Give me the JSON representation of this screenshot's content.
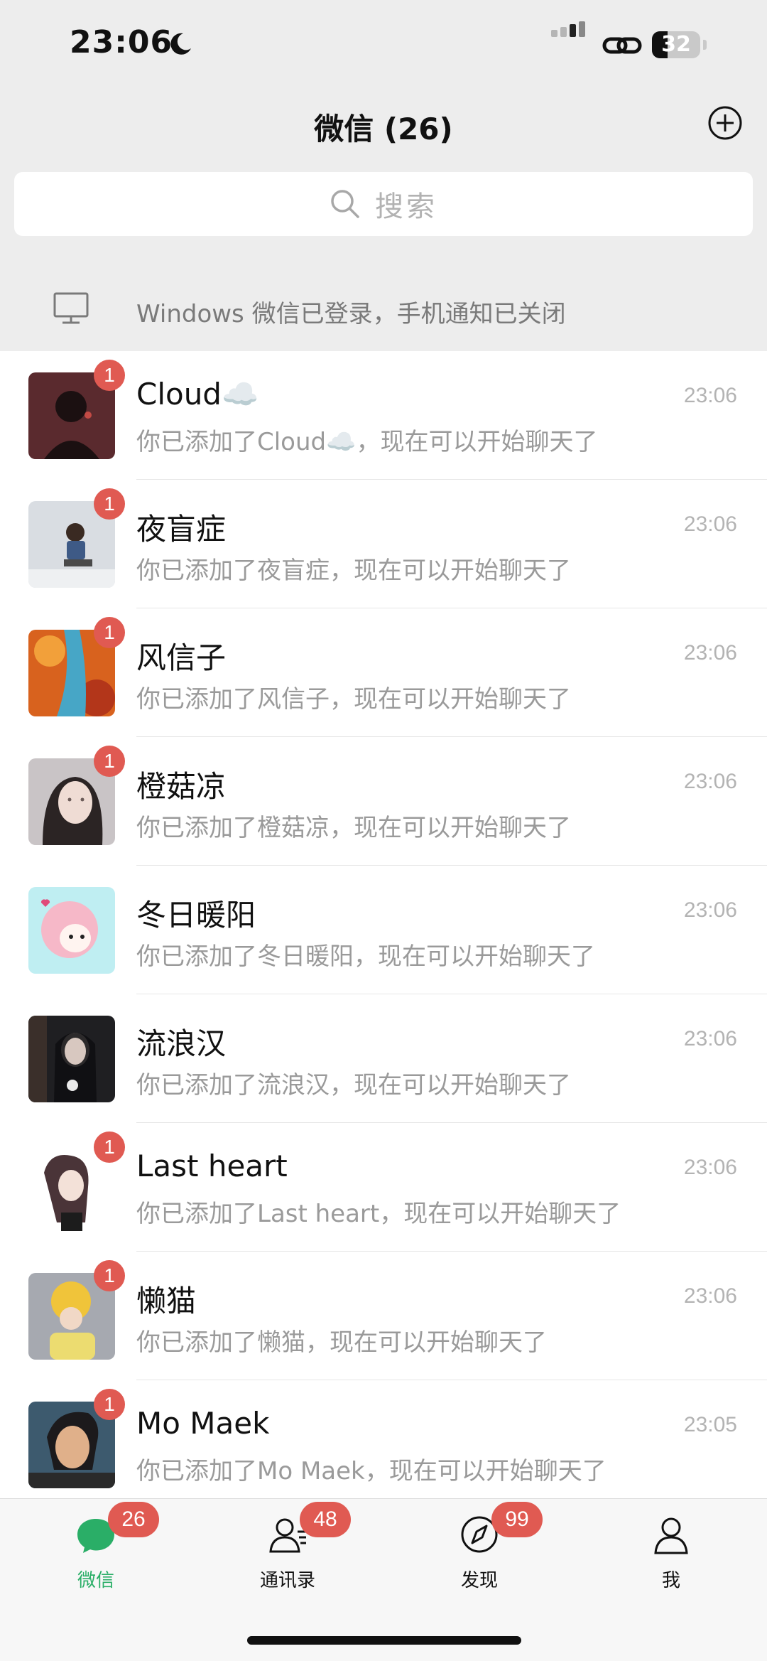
{
  "status_bar": {
    "time": "23:06",
    "battery": "32",
    "battery_level": 0.32
  },
  "header": {
    "title": "微信 (26)"
  },
  "search": {
    "placeholder": "搜索"
  },
  "login_notice": {
    "text": "Windows 微信已登录，手机通知已关闭"
  },
  "chats": [
    {
      "name": "Cloud☁️",
      "preview": "你已添加了Cloud☁️，现在可以开始聊天了",
      "time": "23:06",
      "unread": "1"
    },
    {
      "name": "夜盲症",
      "preview": "你已添加了夜盲症，现在可以开始聊天了",
      "time": "23:06",
      "unread": "1"
    },
    {
      "name": "风信子",
      "preview": "你已添加了风信子，现在可以开始聊天了",
      "time": "23:06",
      "unread": "1"
    },
    {
      "name": "橙菇凉",
      "preview": "你已添加了橙菇凉，现在可以开始聊天了",
      "time": "23:06",
      "unread": "1"
    },
    {
      "name": "冬日暖阳",
      "preview": "你已添加了冬日暖阳，现在可以开始聊天了",
      "time": "23:06",
      "unread": ""
    },
    {
      "name": "流浪汉",
      "preview": "你已添加了流浪汉，现在可以开始聊天了",
      "time": "23:06",
      "unread": ""
    },
    {
      "name": "Last heart",
      "preview": "你已添加了Last heart，现在可以开始聊天了",
      "time": "23:06",
      "unread": "1"
    },
    {
      "name": "懒猫",
      "preview": "你已添加了懒猫，现在可以开始聊天了",
      "time": "23:06",
      "unread": "1"
    },
    {
      "name": "Mo Maek",
      "preview": "你已添加了Mo Maek，现在可以开始聊天了",
      "time": "23:05",
      "unread": "1"
    }
  ],
  "avatar_colors": [
    "#5a2a2e",
    "#d9dde2",
    "#d8621e",
    "#c9c4c6",
    "#bfeef2",
    "#1f1f22",
    "#f4efee",
    "#e9d36a",
    "#3d5a6e"
  ],
  "avatar_accents": [
    "#c24a44",
    "#3e5a86",
    "#47a6c6",
    "#6b5b58",
    "#f6b8c8",
    "#e9e9e9",
    "#4a3438",
    "#f0c43a",
    "#e0b08a"
  ],
  "tabs": [
    {
      "label": "微信",
      "badge": "26",
      "icon": "chat-bubble-icon",
      "active": true
    },
    {
      "label": "通讯录",
      "badge": "48",
      "icon": "contacts-icon",
      "active": false
    },
    {
      "label": "发现",
      "badge": "99",
      "icon": "compass-icon",
      "active": false
    },
    {
      "label": "我",
      "badge": "",
      "icon": "person-icon",
      "active": false
    }
  ],
  "colors": {
    "accent": "#2aae67",
    "badge": "#e05a52",
    "background": "#ededed"
  }
}
